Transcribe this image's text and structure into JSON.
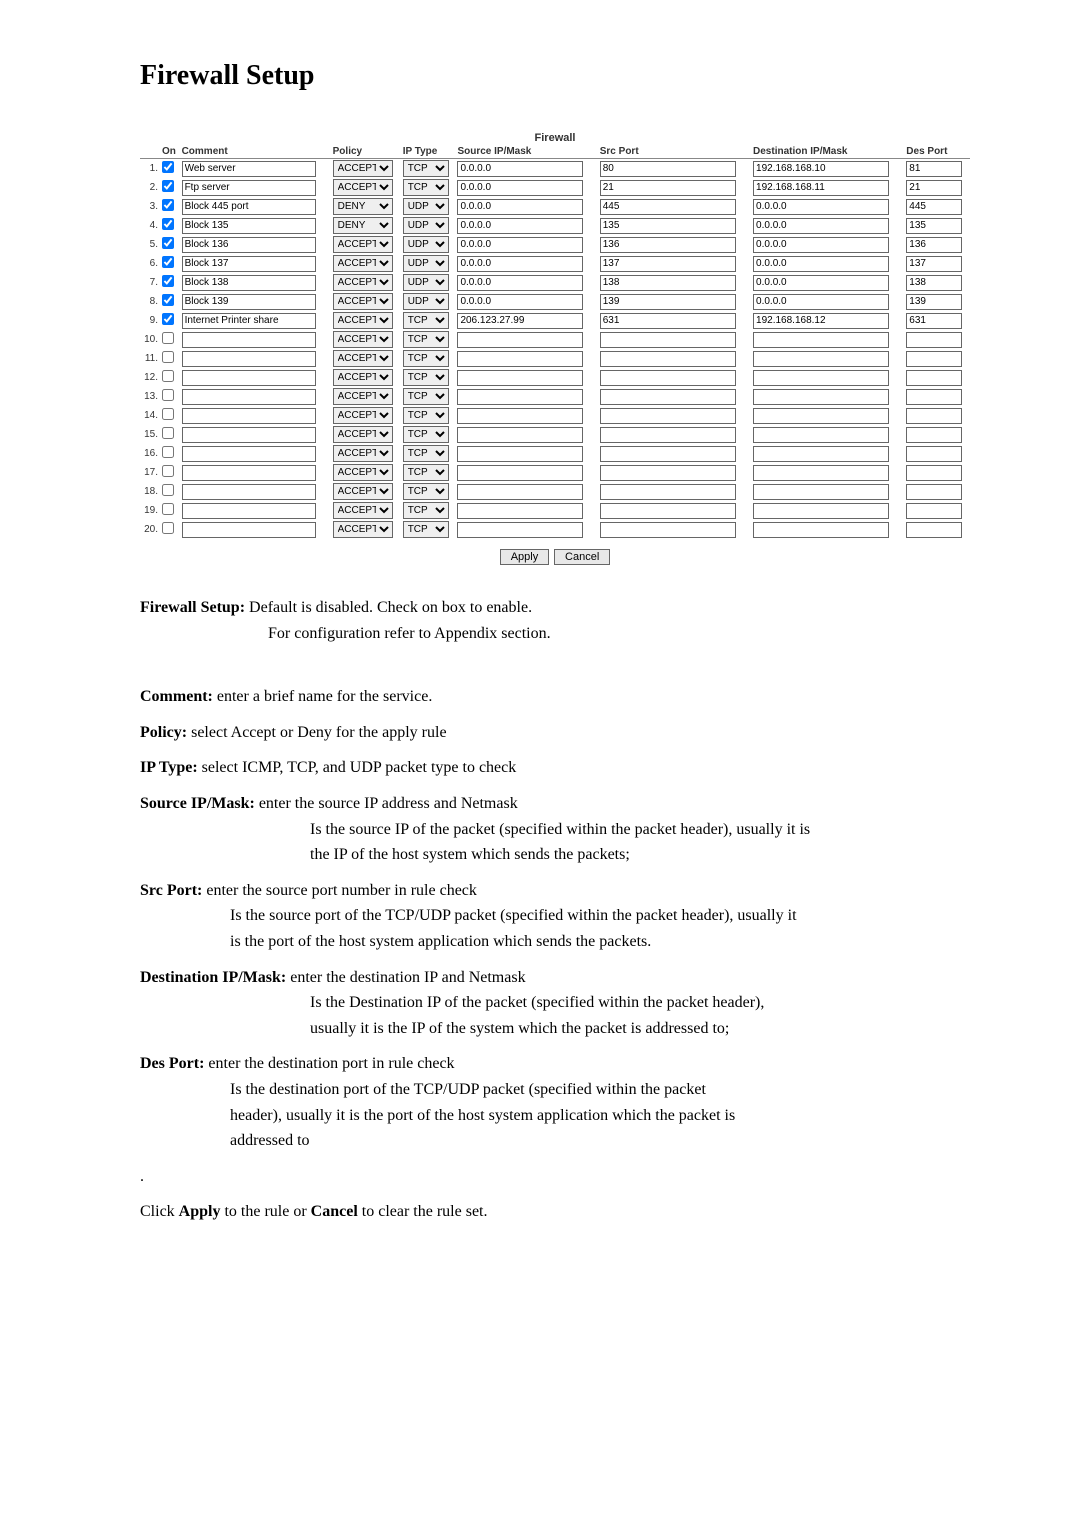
{
  "page": {
    "heading": "Firewall Setup",
    "table_title": "Firewall"
  },
  "headers": {
    "on": "On",
    "comment": "Comment",
    "policy": "Policy",
    "iptype": "IP Type",
    "srcip": "Source IP/Mask",
    "srcport": "Src Port",
    "dstip": "Destination IP/Mask",
    "dstport": "Des Port"
  },
  "buttons": {
    "apply": "Apply",
    "cancel": "Cancel"
  },
  "rows": [
    {
      "n": "1.",
      "on": true,
      "comment": "Web server",
      "policy": "ACCEPT",
      "iptype": "TCP",
      "srcip": "0.0.0.0",
      "srcport": "80",
      "dstip": "192.168.168.10",
      "dstport": "81"
    },
    {
      "n": "2.",
      "on": true,
      "comment": "Ftp server",
      "policy": "ACCEPT",
      "iptype": "TCP",
      "srcip": "0.0.0.0",
      "srcport": "21",
      "dstip": "192.168.168.11",
      "dstport": "21"
    },
    {
      "n": "3.",
      "on": true,
      "comment": "Block 445 port",
      "policy": "DENY",
      "iptype": "UDP",
      "srcip": "0.0.0.0",
      "srcport": "445",
      "dstip": "0.0.0.0",
      "dstport": "445"
    },
    {
      "n": "4.",
      "on": true,
      "comment": "Block 135",
      "policy": "DENY",
      "iptype": "UDP",
      "srcip": "0.0.0.0",
      "srcport": "135",
      "dstip": "0.0.0.0",
      "dstport": "135"
    },
    {
      "n": "5.",
      "on": true,
      "comment": "Block 136",
      "policy": "ACCEPT",
      "iptype": "UDP",
      "srcip": "0.0.0.0",
      "srcport": "136",
      "dstip": "0.0.0.0",
      "dstport": "136"
    },
    {
      "n": "6.",
      "on": true,
      "comment": "Block 137",
      "policy": "ACCEPT",
      "iptype": "UDP",
      "srcip": "0.0.0.0",
      "srcport": "137",
      "dstip": "0.0.0.0",
      "dstport": "137"
    },
    {
      "n": "7.",
      "on": true,
      "comment": "Block 138",
      "policy": "ACCEPT",
      "iptype": "UDP",
      "srcip": "0.0.0.0",
      "srcport": "138",
      "dstip": "0.0.0.0",
      "dstport": "138"
    },
    {
      "n": "8.",
      "on": true,
      "comment": "Block 139",
      "policy": "ACCEPT",
      "iptype": "UDP",
      "srcip": "0.0.0.0",
      "srcport": "139",
      "dstip": "0.0.0.0",
      "dstport": "139"
    },
    {
      "n": "9.",
      "on": true,
      "comment": "Internet Printer share",
      "policy": "ACCEPT",
      "iptype": "TCP",
      "srcip": "206.123.27.99",
      "srcport": "631",
      "dstip": "192.168.168.12",
      "dstport": "631"
    },
    {
      "n": "10.",
      "on": false,
      "comment": "",
      "policy": "ACCEPT",
      "iptype": "TCP",
      "srcip": "",
      "srcport": "",
      "dstip": "",
      "dstport": ""
    },
    {
      "n": "11.",
      "on": false,
      "comment": "",
      "policy": "ACCEPT",
      "iptype": "TCP",
      "srcip": "",
      "srcport": "",
      "dstip": "",
      "dstport": ""
    },
    {
      "n": "12.",
      "on": false,
      "comment": "",
      "policy": "ACCEPT",
      "iptype": "TCP",
      "srcip": "",
      "srcport": "",
      "dstip": "",
      "dstport": ""
    },
    {
      "n": "13.",
      "on": false,
      "comment": "",
      "policy": "ACCEPT",
      "iptype": "TCP",
      "srcip": "",
      "srcport": "",
      "dstip": "",
      "dstport": ""
    },
    {
      "n": "14.",
      "on": false,
      "comment": "",
      "policy": "ACCEPT",
      "iptype": "TCP",
      "srcip": "",
      "srcport": "",
      "dstip": "",
      "dstport": ""
    },
    {
      "n": "15.",
      "on": false,
      "comment": "",
      "policy": "ACCEPT",
      "iptype": "TCP",
      "srcip": "",
      "srcport": "",
      "dstip": "",
      "dstport": ""
    },
    {
      "n": "16.",
      "on": false,
      "comment": "",
      "policy": "ACCEPT",
      "iptype": "TCP",
      "srcip": "",
      "srcport": "",
      "dstip": "",
      "dstport": ""
    },
    {
      "n": "17.",
      "on": false,
      "comment": "",
      "policy": "ACCEPT",
      "iptype": "TCP",
      "srcip": "",
      "srcport": "",
      "dstip": "",
      "dstport": ""
    },
    {
      "n": "18.",
      "on": false,
      "comment": "",
      "policy": "ACCEPT",
      "iptype": "TCP",
      "srcip": "",
      "srcport": "",
      "dstip": "",
      "dstport": ""
    },
    {
      "n": "19.",
      "on": false,
      "comment": "",
      "policy": "ACCEPT",
      "iptype": "TCP",
      "srcip": "",
      "srcport": "",
      "dstip": "",
      "dstport": ""
    },
    {
      "n": "20.",
      "on": false,
      "comment": "",
      "policy": "ACCEPT",
      "iptype": "TCP",
      "srcip": "",
      "srcport": "",
      "dstip": "",
      "dstport": ""
    }
  ],
  "text": {
    "fs_label": "Firewall Setup: ",
    "fs_line1": "Default is disabled. Check on box to enable.",
    "fs_line2": "For configuration refer to Appendix section.",
    "comment_label": "Comment: ",
    "comment_text": "enter a brief name for the service.",
    "policy_label": "Policy: ",
    "policy_text": "select Accept or Deny for the apply rule",
    "iptype_label": "IP Type: ",
    "iptype_text": "select ICMP, TCP, and UDP packet type to check",
    "srcip_label": "Source IP/Mask: ",
    "srcip_text": "enter the source IP address and Netmask",
    "srcip_l1": "Is the source IP of the packet (specified within the packet header), usually it is",
    "srcip_l2": "the IP of the host system which sends the packets;",
    "srcport_label": "Src Port: ",
    "srcport_text": "enter the source port number in rule check",
    "srcport_l1": "Is the source port of the TCP/UDP packet (specified within the packet header), usually it",
    "srcport_l2": "is the port of the host system application which sends the packets.",
    "dstip_label": "Destination IP/Mask: ",
    "dstip_text": "enter the destination IP and Netmask",
    "dstip_l1": "Is the Destination IP of the packet (specified within the packet header),",
    "dstip_l2": "usually it is the IP of the system which the packet is addressed to;",
    "dstport_label": "Des Port: ",
    "dstport_text": "enter the destination port in rule check",
    "dstport_l1": "Is the destination port of the TCP/UDP packet (specified within the packet",
    "dstport_l2": "header), usually it is the port of the host system application which the packet is",
    "dstport_l3": "addressed to",
    "dot": ".",
    "click1": "Click ",
    "apply_b": "Apply",
    "click2": " to the rule or ",
    "cancel_b": "Cancel",
    "click3": " to clear the rule set."
  }
}
